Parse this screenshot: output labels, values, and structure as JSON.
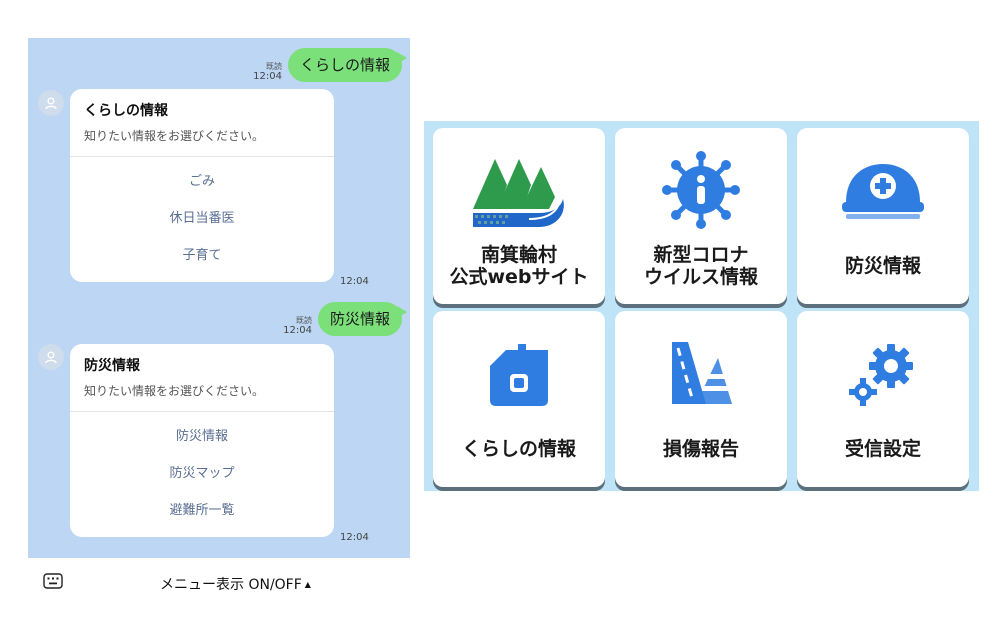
{
  "chat": {
    "messages": [
      {
        "read": "既読",
        "time": "12:04",
        "text": "くらしの情報"
      },
      {
        "read": "既読",
        "time": "12:04",
        "text": "防災情報"
      }
    ],
    "cards": [
      {
        "title": "くらしの情報",
        "subtitle": "知りたい情報をお選びください。",
        "options": [
          "ごみ",
          "休日当番医",
          "子育て"
        ],
        "time": "12:04"
      },
      {
        "title": "防災情報",
        "subtitle": "知りたい情報をお選びください。",
        "options": [
          "防災情報",
          "防災マップ",
          "避難所一覧"
        ],
        "time": "12:04"
      }
    ]
  },
  "menu_toggle": {
    "label": "メニュー表示 ON/OFF",
    "arrow": "▲"
  },
  "rich_menu": {
    "tiles": [
      {
        "label": "南箕輪村\n公式webサイト",
        "icon": "village-logo-icon"
      },
      {
        "label": "新型コロナ\nウイルス情報",
        "icon": "virus-info-icon"
      },
      {
        "label": "防災情報",
        "icon": "helmet-icon"
      },
      {
        "label": "くらしの情報",
        "icon": "house-icon"
      },
      {
        "label": "損傷報告",
        "icon": "road-cone-icon"
      },
      {
        "label": "受信設定",
        "icon": "gears-icon"
      }
    ]
  },
  "colors": {
    "chat_bg": "#bcd6f3",
    "bubble_green": "#7be07a",
    "menu_bg": "#bfe3f7",
    "icon_blue": "#2f7de1",
    "logo_green": "#2e9a4b"
  }
}
